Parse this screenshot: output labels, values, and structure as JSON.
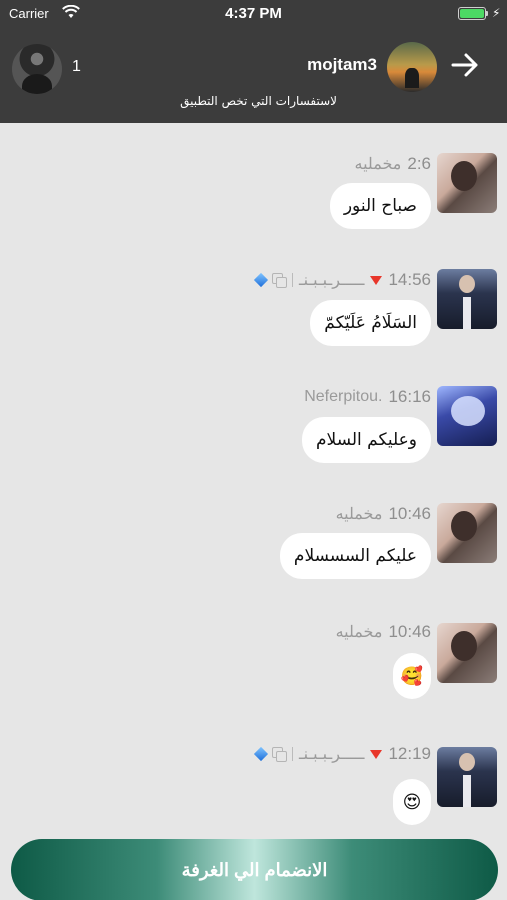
{
  "status_bar": {
    "carrier": "Carrier",
    "time": "4:37 PM"
  },
  "header": {
    "member_count": "1",
    "room_name": "mojtam3",
    "room_description": "لاستفسارات التي تخص التطبيق"
  },
  "messages": [
    {
      "sender": "مخمليه",
      "time": "2:6",
      "text": "صباح النور",
      "avatar": "girl-avatar"
    },
    {
      "sender": "ـــــرـبـبـنـ",
      "time": "14:56",
      "text": "السَلَامُ عَلَيّكمّ",
      "avatar": "suit-avatar"
    },
    {
      "sender": "Neferpitou.",
      "time": "16:16",
      "text": "وعليكم السلام",
      "avatar": "anime-avatar"
    },
    {
      "sender": "مخمليه",
      "time": "10:46",
      "text": "عليكم السسسلام",
      "avatar": "girl-avatar"
    },
    {
      "sender": "مخمليه",
      "time": "10:46",
      "text": "🥰",
      "avatar": "girl-avatar"
    },
    {
      "sender": "ـــــرـبـبـنـ",
      "time": "12:19",
      "text": "😍",
      "avatar": "suit-avatar"
    }
  ],
  "join_button": {
    "label": "الانضمام الي الغرفة"
  },
  "colors": {
    "header_bg": "#3c3c3c",
    "chat_bg": "#e6e6e6",
    "join_gradient_dark": "#0e5a46",
    "join_gradient_light": "#bfe6dc",
    "rank_triangle": "#e8362a",
    "diamond": "#1e6fd9"
  }
}
